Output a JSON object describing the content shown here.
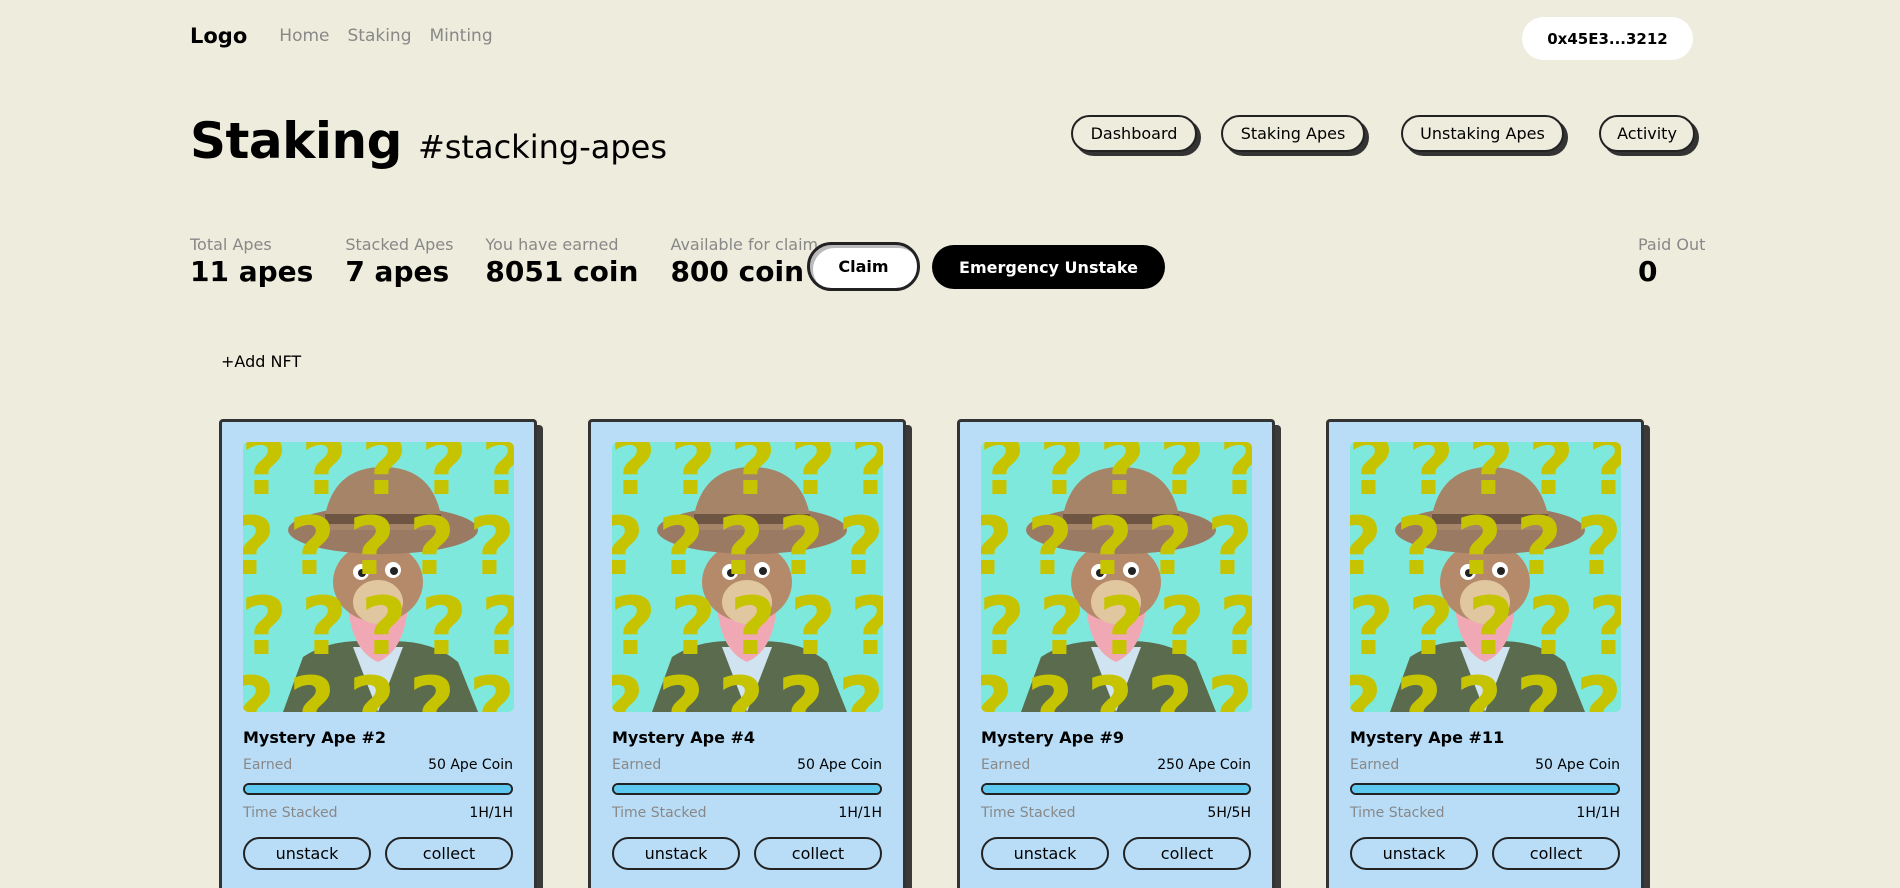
{
  "nav": {
    "logo": "Logo",
    "links": [
      "Home",
      "Staking",
      "Minting"
    ],
    "wallet": "0x45E3...3212"
  },
  "header": {
    "title": "Staking",
    "subtitle": "#stacking-apes",
    "tabs": [
      "Dashboard",
      "Staking Apes",
      "Unstaking Apes",
      "Activity"
    ]
  },
  "stats": [
    {
      "label": "Total Apes",
      "value": "11 apes"
    },
    {
      "label": "Stacked Apes",
      "value": "7 apes"
    },
    {
      "label": "You have earned",
      "value": "8051 coin"
    },
    {
      "label": "Available for claim",
      "value": "800 coin"
    }
  ],
  "actions": {
    "claim": "Claim",
    "emergency": "Emergency Unstake"
  },
  "paid_out": {
    "label": "Paid Out",
    "value": "0"
  },
  "add_nft": "+Add NFT",
  "cards": [
    {
      "name": "Mystery Ape #2",
      "earned_label": "Earned",
      "earned": "50 Ape Coin",
      "progress": 1.0,
      "time_label": "Time Stacked",
      "time": "1H/1H",
      "unstack": "unstack",
      "collect": "collect"
    },
    {
      "name": "Mystery Ape #4",
      "earned_label": "Earned",
      "earned": "50 Ape Coin",
      "progress": 1.0,
      "time_label": "Time Stacked",
      "time": "1H/1H",
      "unstack": "unstack",
      "collect": "collect"
    },
    {
      "name": "Mystery Ape #9",
      "earned_label": "Earned",
      "earned": "250 Ape Coin",
      "progress": 1.0,
      "time_label": "Time Stacked",
      "time": "5H/5H",
      "unstack": "unstack",
      "collect": "collect"
    },
    {
      "name": "Mystery Ape #11",
      "earned_label": "Earned",
      "earned": "50 Ape Coin",
      "progress": 1.0,
      "time_label": "Time Stacked",
      "time": "1H/1H",
      "unstack": "unstack",
      "collect": "collect"
    }
  ],
  "colors": {
    "background": "#eeecdd",
    "card": "#b9ddf7",
    "progress": "#5ec9f0",
    "nft_bg": "#7fe8dc",
    "question_mark": "#c6c400"
  }
}
